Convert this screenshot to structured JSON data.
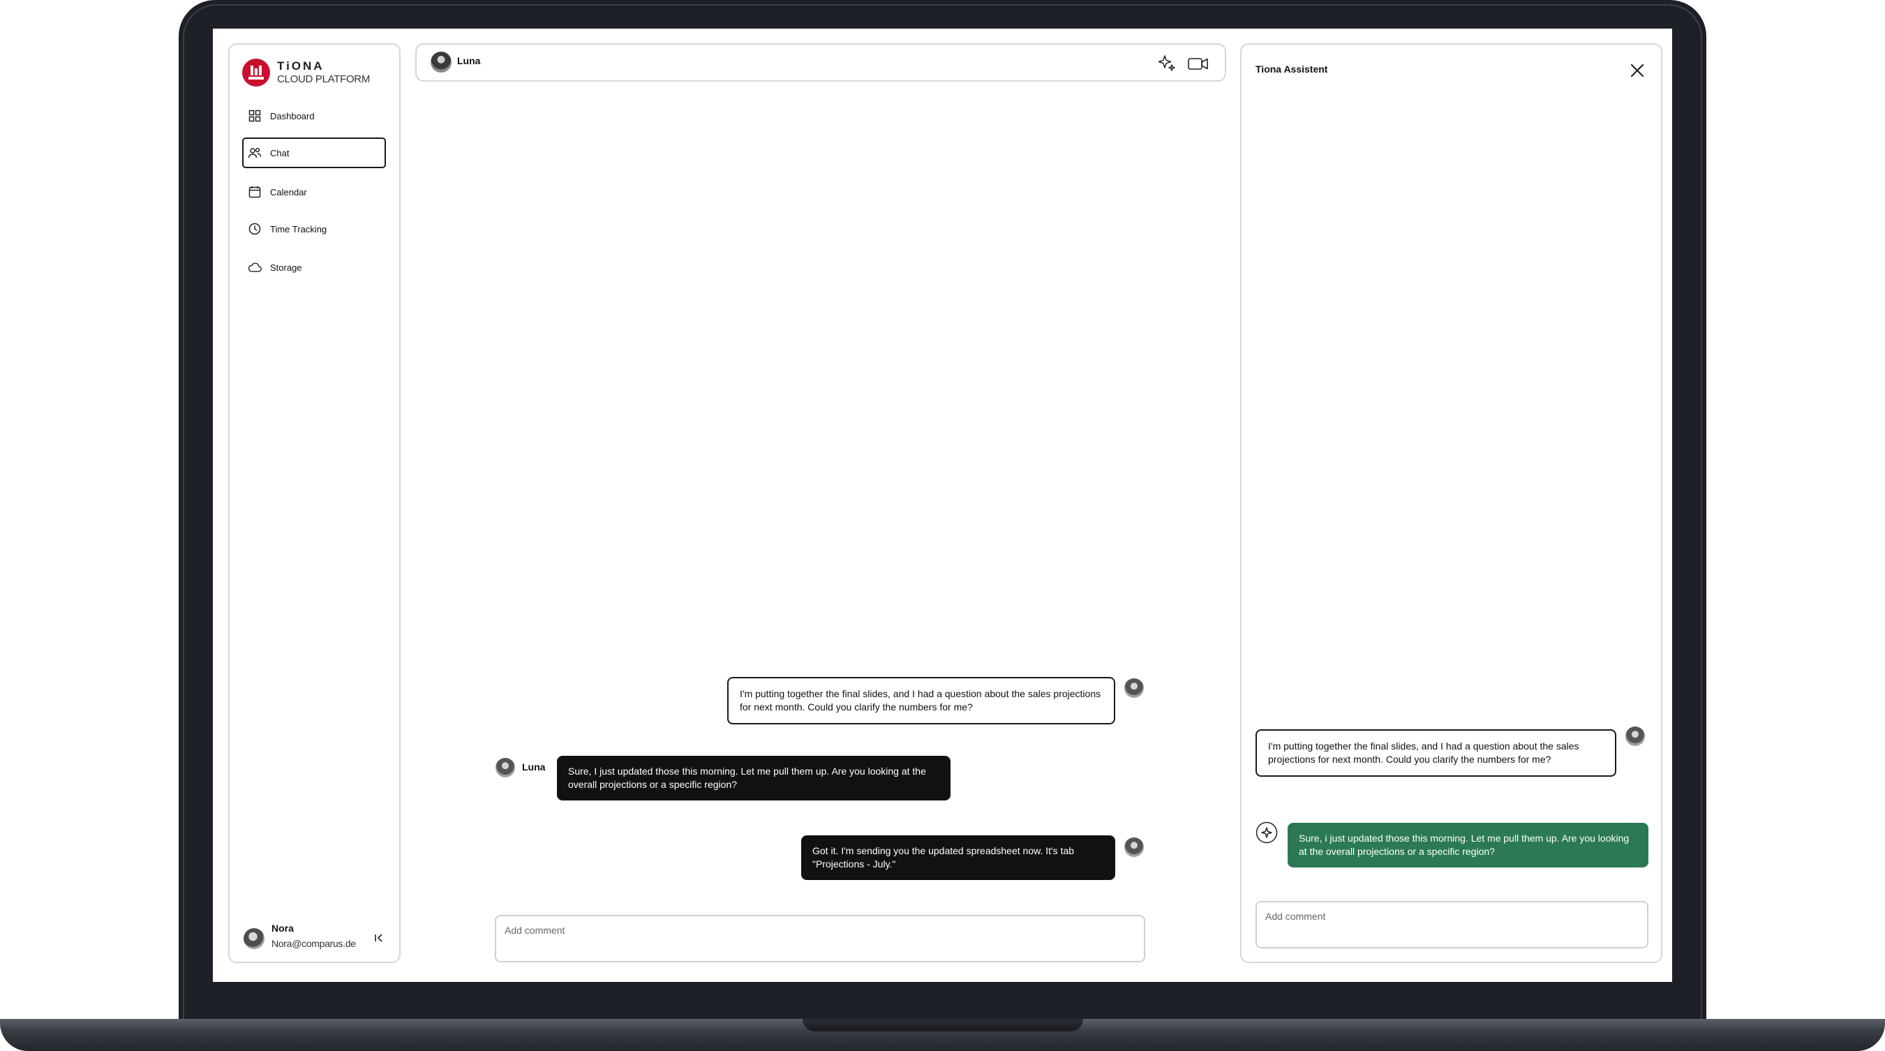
{
  "brand": {
    "name": "TiONA",
    "subtitle": "CLOUD PLATFORM",
    "color": "#c8102e"
  },
  "sidebar": {
    "items": [
      {
        "label": "Dashboard",
        "icon": "dashboard-grid-icon",
        "active": false
      },
      {
        "label": "Chat",
        "icon": "users-icon",
        "active": true
      },
      {
        "label": "Calendar",
        "icon": "calendar-icon",
        "active": false
      },
      {
        "label": "Time Tracking",
        "icon": "clock-icon",
        "active": false
      },
      {
        "label": "Storage",
        "icon": "cloud-icon",
        "active": false
      }
    ],
    "user": {
      "name": "Nora",
      "email": "Nora@comparus.de"
    }
  },
  "chat": {
    "contact_name": "Luna",
    "messages": [
      {
        "from": "me",
        "text": "I'm putting together the final slides, and I had a question about the sales projections for next month. Could you clarify the numbers for me?"
      },
      {
        "from": "Luna",
        "sender_label": "Luna",
        "text": "Sure, I just updated those this morning. Let me pull them up. Are you looking at the overall projections or a specific region?"
      },
      {
        "from": "me",
        "text": "Got it. I'm sending you the updated spreadsheet now. It's tab \"Projections - July.\""
      }
    ],
    "comment_placeholder": "Add comment"
  },
  "assistant": {
    "title": "Tiona Assistent",
    "messages": [
      {
        "from": "me",
        "text": "I'm putting together the final slides, and I had a question about the sales projections for next month. Could you clarify the numbers for me?"
      },
      {
        "from": "assistant",
        "text": "Sure, i just updated those this morning. Let me pull them up. Are you looking at the overall projections or a specific region?"
      }
    ],
    "comment_placeholder": "Add comment",
    "accent_color": "#2b7a55"
  }
}
